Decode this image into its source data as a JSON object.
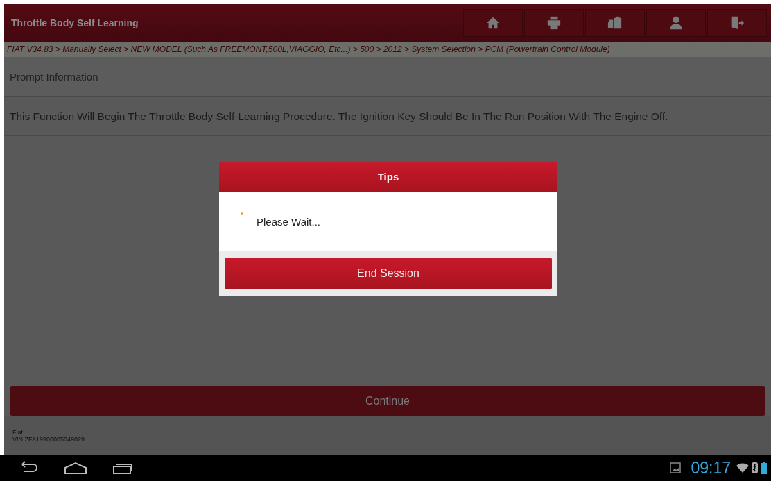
{
  "header": {
    "title": "Throttle Body Self Learning"
  },
  "breadcrumb": "FIAT V34.83 > Manually Select > NEW MODEL (Such As FREEMONT,500L,VIAGGIO, Etc...) > 500 > 2012 > System Selection > PCM (Powertrain Control Module)",
  "section_title": "Prompt Information",
  "message": "This Function Will Begin The Throttle Body Self-Learning Procedure. The Ignition Key Should Be In The Run Position With The Engine Off.",
  "continue_button": {
    "label": "Continue"
  },
  "footer": {
    "make": "Fiat",
    "vin": "VIN ZFA19900005049029"
  },
  "dialog": {
    "title": "Tips",
    "message": "Please Wait...",
    "button": "End Session"
  },
  "status_bar": {
    "time": "09:17"
  }
}
